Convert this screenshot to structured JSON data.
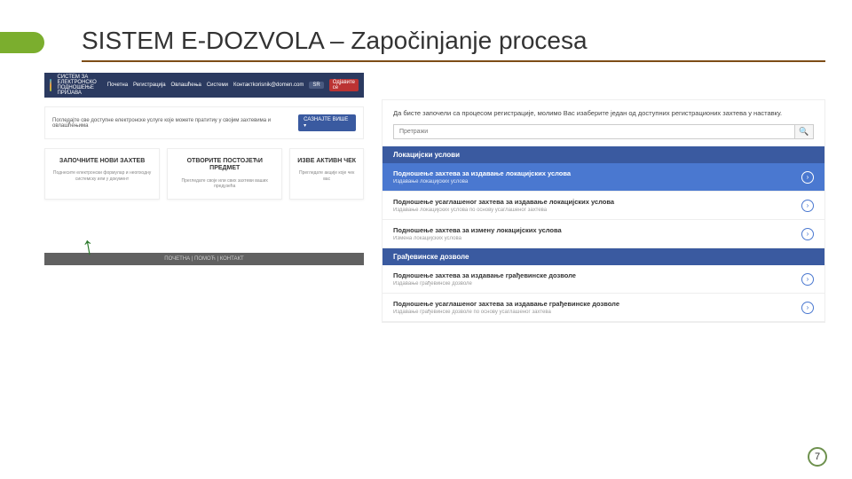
{
  "slide": {
    "title": "SISTEM E-DOZVOLA – Započinjanje procesa",
    "page_number": "7"
  },
  "left": {
    "brand_line1": "СИСТЕМ ЗА ЕЛЕКТРОНСКО",
    "brand_line2": "ПОДНОШЕЊЕ ПРИЈАВА",
    "nav": [
      "Почетна",
      "Регистрација",
      "Овлашћења",
      "Системи",
      "Контакт"
    ],
    "user": "korisnik@domen.com",
    "lang": "SR",
    "logout": "Одјавите се",
    "banner": "Погледајте све доступне електронске услуге које можете пратитиy у својим захтевима и овлашћењима",
    "banner_btn": "САЗНАЈТЕ ВИШЕ ▾",
    "cards": [
      {
        "title": "ЗАПОЧНИТЕ НОВИ ЗАХТЕВ",
        "sub": "Поднесите електронски формулар и неопходну системску или у документ"
      },
      {
        "title": "ОТВОРИТЕ ПОСТОЈЕЋИ ПРЕДМЕТ",
        "sub": "Прегледате своје или свих захтеви ваших предузећа"
      },
      {
        "title": "ИЗВЕ АКТИВН ЧЕК",
        "sub": "Прегледате акције које чек вас"
      }
    ],
    "footer": "ПОЧЕТНА   |   ПОМОЋ   |   КОНТАКТ"
  },
  "right": {
    "intro": "Да бисте започели са процесом регистрације, молимо Вас изаберите један од доступних регистрационих захтева у наставку.",
    "search_placeholder": "Претражи",
    "sections": [
      {
        "title": "Локацијски услови",
        "items": [
          {
            "title": "Подношење захтева за издавање локацијских услова",
            "sub": "Издавање локацијских услова",
            "selected": true
          },
          {
            "title": "Подношење усаглашеног захтева за издавање локацијских услова",
            "sub": "Издавање локацијских услова по основу усаглашеног захтева",
            "selected": false
          },
          {
            "title": "Подношење захтева за измену локацијских услова",
            "sub": "Измена локацијских услова",
            "selected": false
          }
        ]
      },
      {
        "title": "Грађевинске дозволе",
        "items": [
          {
            "title": "Подношење захтева за издавање грађевинске дозволе",
            "sub": "Издавање грађевинске дозволе",
            "selected": false
          },
          {
            "title": "Подношење усаглашеног захтева за издавање грађевинске дозволе",
            "sub": "Издавање грађевинске дозволе по основу усаглашеног захтева",
            "selected": false
          }
        ]
      }
    ]
  }
}
